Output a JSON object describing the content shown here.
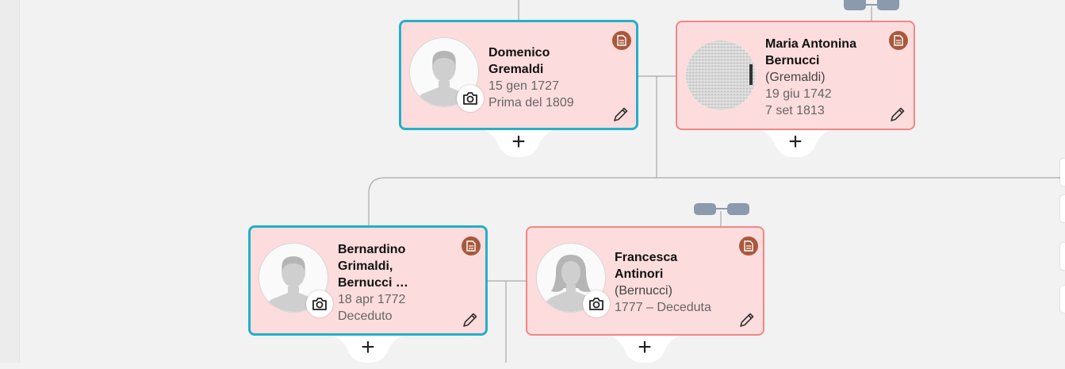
{
  "colors": {
    "male_border": "#23b0ca",
    "female_border": "#f08787",
    "card_bg": "#fcdcdc",
    "note_badge": "#a8593d",
    "connector": "#8c9aae"
  },
  "people": {
    "domenico": {
      "name_line1": "Domenico",
      "name_line2": "Gremaldi",
      "birth": "15 gen 1727",
      "death": "Prima del 1809",
      "icon": "male-silhouette"
    },
    "maria": {
      "name_line1": "Maria Antonina",
      "name_line2": "Bernucci",
      "maiden": "(Gremaldi)",
      "birth": "19 giu 1742",
      "death": "7 set 1813",
      "icon": "photo"
    },
    "bernardino": {
      "name_line1": "Bernardino",
      "name_line2": "Grimaldi,",
      "name_line3": "Bernucci …",
      "birth": "18 apr 1772",
      "death": "Deceduto",
      "icon": "male-silhouette"
    },
    "francesca": {
      "name_line1": "Francesca",
      "name_line2": "Antinori",
      "maiden": "(Bernucci)",
      "dates": "1777 – Deceduta",
      "icon": "female-silhouette"
    }
  },
  "add_symbol": "+"
}
